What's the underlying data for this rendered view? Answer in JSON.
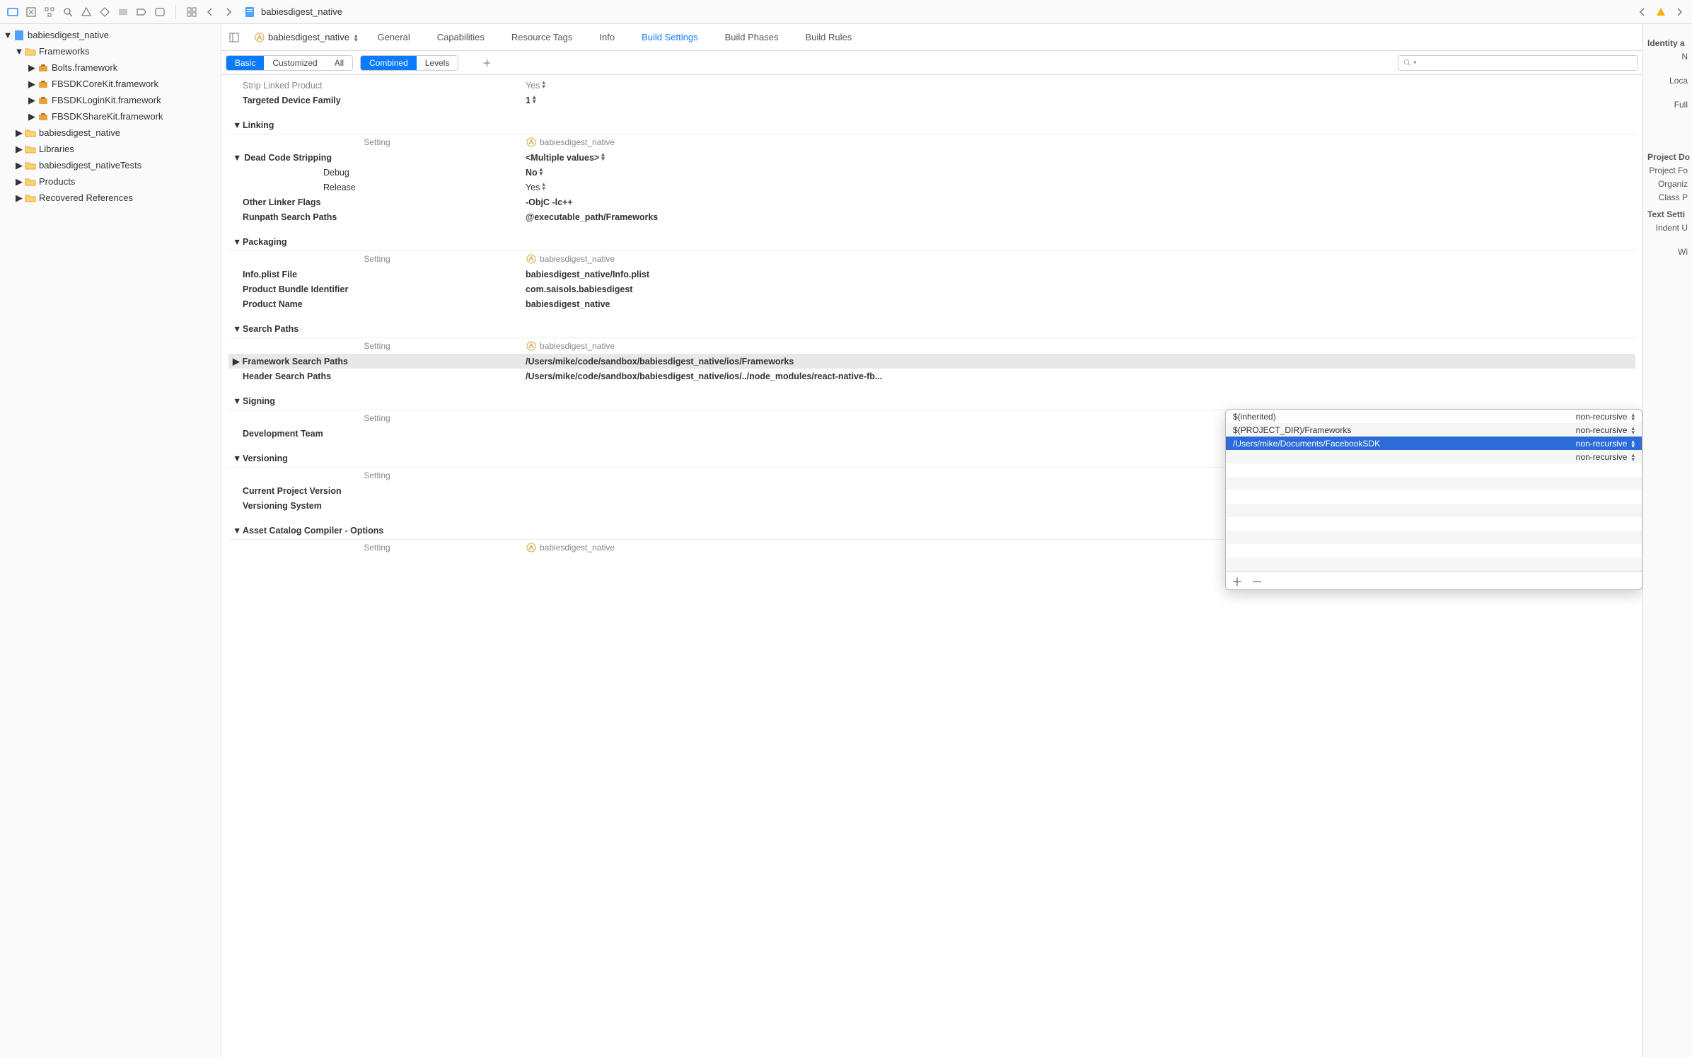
{
  "project_name": "babiesdigest_native",
  "jump_bar_file": "babiesdigest_native",
  "sidebar": {
    "root": "babiesdigest_native",
    "frameworks_label": "Frameworks",
    "fw1": "Bolts.framework",
    "fw2": "FBSDKCoreKit.framework",
    "fw3": "FBSDKLoginKit.framework",
    "fw4": "FBSDKShareKit.framework",
    "folder_native": "babiesdigest_native",
    "folder_libs": "Libraries",
    "folder_tests": "babiesdigest_nativeTests",
    "folder_products": "Products",
    "folder_recovered": "Recovered References"
  },
  "tabs": {
    "target": "babiesdigest_native",
    "general": "General",
    "capabilities": "Capabilities",
    "resource_tags": "Resource Tags",
    "info": "Info",
    "build_settings": "Build Settings",
    "build_phases": "Build Phases",
    "build_rules": "Build Rules"
  },
  "filter": {
    "basic": "Basic",
    "customized": "Customized",
    "all": "All",
    "combined": "Combined",
    "levels": "Levels"
  },
  "settings": {
    "strip_linked_product": "Strip Linked Product",
    "strip_linked_product_val": "Yes",
    "targeted_device_family": "Targeted Device Family",
    "targeted_device_family_val": "1",
    "linking_header": "Linking",
    "setting_label": "Setting",
    "target_col": "babiesdigest_native",
    "dead_code_stripping": "Dead Code Stripping",
    "dead_code_stripping_val": "<Multiple values>",
    "debug": "Debug",
    "debug_val": "No",
    "release": "Release",
    "release_val": "Yes",
    "other_linker_flags": "Other Linker Flags",
    "other_linker_flags_val": "-ObjC -lc++",
    "runpath": "Runpath Search Paths",
    "runpath_val": "@executable_path/Frameworks",
    "packaging_header": "Packaging",
    "info_plist": "Info.plist File",
    "info_plist_val": "babiesdigest_native/Info.plist",
    "bundle_id": "Product Bundle Identifier",
    "bundle_id_val": "com.saisols.babiesdigest",
    "product_name": "Product Name",
    "product_name_val": "babiesdigest_native",
    "search_paths_header": "Search Paths",
    "fw_search_paths": "Framework Search Paths",
    "fw_search_paths_val": "/Users/mike/code/sandbox/babiesdigest_native/ios/Frameworks",
    "header_search_paths": "Header Search Paths",
    "header_search_paths_val": "/Users/mike/code/sandbox/babiesdigest_native/ios/../node_modules/react-native-fb...",
    "signing_header": "Signing",
    "dev_team": "Development Team",
    "versioning_header": "Versioning",
    "current_version": "Current Project Version",
    "versioning_system": "Versioning System",
    "asset_catalog_header": "Asset Catalog Compiler - Options"
  },
  "popover": {
    "row1_path": "$(inherited)",
    "row1_rec": "non-recursive",
    "row2_path": "$(PROJECT_DIR)/Frameworks",
    "row2_rec": "non-recursive",
    "row3_path": "/Users/mike/Documents/FacebookSDK",
    "row3_rec": "non-recursive",
    "row4_rec": "non-recursive"
  },
  "inspector": {
    "identity_header": "Identity a",
    "name": "N",
    "location": "Loca",
    "full": "Full",
    "project_doc_header": "Project Do",
    "project_format": "Project Fo",
    "organization": "Organiz",
    "class_prefix": "Class P",
    "text_settings_header": "Text Setti",
    "indent": "Indent U",
    "width": "Wi"
  }
}
